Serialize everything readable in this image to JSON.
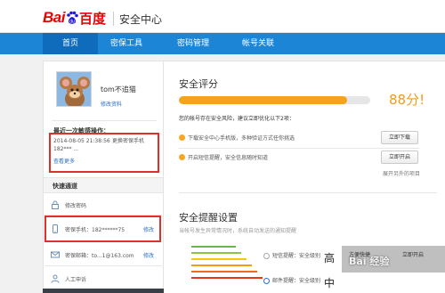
{
  "header": {
    "brand_latin": "Bai",
    "brand_cn": "百度",
    "section_title": "安全中心"
  },
  "nav": {
    "items": [
      {
        "label": "首页",
        "active": true
      },
      {
        "label": "密保工具",
        "active": false
      },
      {
        "label": "密码管理",
        "active": false
      },
      {
        "label": "帐号关联",
        "active": false
      }
    ]
  },
  "colors": {
    "nav": "#1d85d6",
    "nav_active": "#0f6cbd",
    "progress": "#f6a21a",
    "score": "#f29b16",
    "highlight_box": "#e0302b",
    "link": "#2b6fc2"
  },
  "profile": {
    "username": "tom不追猫",
    "edit_link": "修改资料"
  },
  "last_login": {
    "title": "最近一次敏感操作：",
    "time": "2014-08-05 21:38:56",
    "action": "更换密保手机",
    "detail": "182*** ...",
    "more": "查看更多"
  },
  "quick": {
    "title": "快速通道",
    "items": [
      {
        "icon": "lock-icon",
        "label": "修改密码",
        "action": ""
      },
      {
        "icon": "phone-icon",
        "label": "密保手机：182******75",
        "action": "修改"
      },
      {
        "icon": "mail-icon",
        "label": "密保邮箱：to...1@163.com",
        "action": "修改"
      },
      {
        "icon": "person-icon",
        "label": "人工申诉",
        "action": ""
      }
    ]
  },
  "score": {
    "title": "安全评分",
    "value": "88分!",
    "progress_percent": 88,
    "warning": "您的帐号存在安全风险，建议立即优化以下2项：",
    "items": [
      {
        "text": "下载安全中心手机版，多种验证方式任你挑选",
        "button": "立即下载"
      },
      {
        "text": "开启短信提醒，安全信息随时知道",
        "button": "立即开启"
      }
    ],
    "expand": "展开另外的项目"
  },
  "reminder": {
    "title": "安全提醒设置",
    "subtitle": "当帐号发生异常情况时，系统自动发送的通知提醒",
    "options": [
      {
        "label": "短信提醒：安全级别",
        "level": "高"
      },
      {
        "label": "邮件提醒：安全级别",
        "level": "中"
      }
    ]
  },
  "watermark": {
    "text": "Bai 经验",
    "side_text_1": "方便快捷",
    "side_text_2": "立即开启"
  }
}
